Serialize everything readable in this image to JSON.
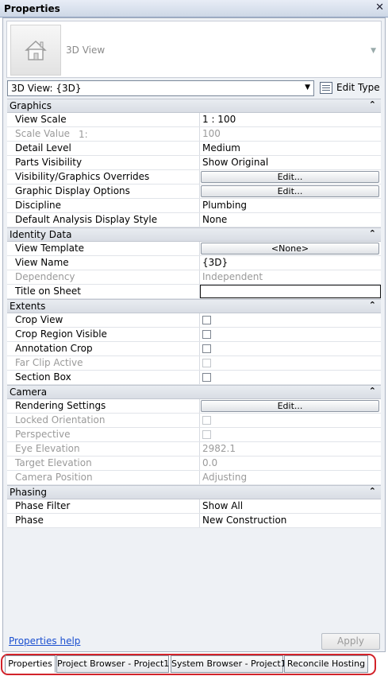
{
  "window": {
    "title": "Properties"
  },
  "type_selector": {
    "name": "3D View"
  },
  "view_instance": {
    "value": "3D View: {3D}"
  },
  "edit_type": {
    "label": "Edit Type"
  },
  "groups": {
    "graphics": {
      "label": "Graphics"
    },
    "identity": {
      "label": "Identity Data"
    },
    "extents": {
      "label": "Extents"
    },
    "camera": {
      "label": "Camera"
    },
    "phasing": {
      "label": "Phasing"
    }
  },
  "graphics": {
    "view_scale": {
      "name": "View Scale",
      "value": "1 : 100"
    },
    "scale_value": {
      "name": "Scale Value",
      "unit": "1:",
      "value": "100"
    },
    "detail_level": {
      "name": "Detail Level",
      "value": "Medium"
    },
    "parts_visibility": {
      "name": "Parts Visibility",
      "value": "Show Original"
    },
    "vg_overrides": {
      "name": "Visibility/Graphics Overrides",
      "value": "Edit..."
    },
    "graphic_display": {
      "name": "Graphic Display Options",
      "value": "Edit..."
    },
    "discipline": {
      "name": "Discipline",
      "value": "Plumbing"
    },
    "default_analysis": {
      "name": "Default Analysis Display Style",
      "value": "None"
    }
  },
  "identity": {
    "view_template": {
      "name": "View Template",
      "value": "<None>"
    },
    "view_name": {
      "name": "View Name",
      "value": "{3D}"
    },
    "dependency": {
      "name": "Dependency",
      "value": "Independent"
    },
    "title_on_sheet": {
      "name": "Title on Sheet",
      "value": ""
    }
  },
  "extents": {
    "crop_view": {
      "name": "Crop View",
      "checked": false
    },
    "crop_region_visible": {
      "name": "Crop Region Visible",
      "checked": false
    },
    "annotation_crop": {
      "name": "Annotation Crop",
      "checked": false
    },
    "far_clip_active": {
      "name": "Far Clip Active",
      "checked": false
    },
    "section_box": {
      "name": "Section Box",
      "checked": false
    }
  },
  "camera": {
    "rendering_settings": {
      "name": "Rendering Settings",
      "value": "Edit..."
    },
    "locked_orientation": {
      "name": "Locked Orientation",
      "checked": false
    },
    "perspective": {
      "name": "Perspective",
      "checked": false
    },
    "eye_elevation": {
      "name": "Eye Elevation",
      "value": "2982.1"
    },
    "target_elevation": {
      "name": "Target Elevation",
      "value": "0.0"
    },
    "camera_position": {
      "name": "Camera Position",
      "value": "Adjusting"
    }
  },
  "phasing": {
    "phase_filter": {
      "name": "Phase Filter",
      "value": "Show All"
    },
    "phase": {
      "name": "Phase",
      "value": "New Construction"
    }
  },
  "footer": {
    "help_link": "Properties help",
    "apply_label": "Apply"
  },
  "tabs": [
    "Properties",
    "Project Browser - Project1",
    "System Browser - Project1",
    "Reconcile Hosting"
  ],
  "icons": {
    "collapse": "collapse-chevron-icon",
    "close": "close-icon",
    "house": "house-3d-icon"
  },
  "colors": {
    "highlight_ring": "#d2232a",
    "link": "#1a4fd0"
  }
}
